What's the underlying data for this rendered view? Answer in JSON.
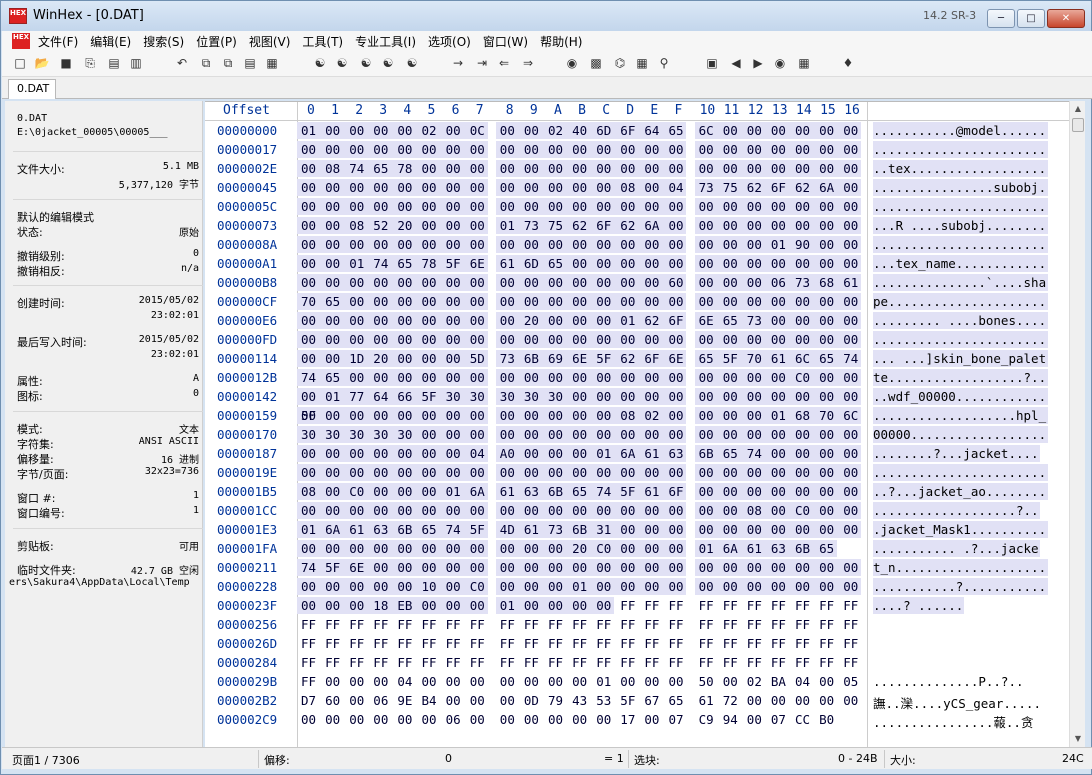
{
  "window": {
    "title": "WinHex - [0.DAT]",
    "version": "14.2 SR-3",
    "icon_label": "HEX"
  },
  "menu": [
    "文件(F)",
    "编辑(E)",
    "搜索(S)",
    "位置(P)",
    "视图(V)",
    "工具(T)",
    "专业工具(I)",
    "选项(O)",
    "窗口(W)",
    "帮助(H)"
  ],
  "tab": {
    "label": "0.DAT"
  },
  "info": {
    "file_name": "0.DAT",
    "file_path": "E:\\0jacket_00005\\00005___",
    "size_label": "文件大小:",
    "size_mb": "5.1 MB",
    "size_bytes": "5,377,120 字节",
    "edit_mode_label": "默认的编辑模式",
    "state_label": "状态:",
    "state_value": "原始",
    "undo_level_label": "撤销级别:",
    "undo_level_value": "0",
    "undo_reverse_label": "撤销相反:",
    "undo_reverse_value": "n/a",
    "created_label": "创建时间:",
    "created_date": "2015/05/02",
    "created_time": "23:02:01",
    "modified_label": "最后写入时间:",
    "modified_date": "2015/05/02",
    "modified_time": "23:02:01",
    "attr_label": "属性:",
    "attr_value": "A",
    "icon_label": "图标:",
    "icon_value": "0",
    "mode_label": "模式:",
    "mode_value": "文本",
    "charset_label": "字符集:",
    "charset_value": "ANSI ASCII",
    "offset_label": "偏移量:",
    "offset_value": "16 进制",
    "bpp_label": "字节/页面:",
    "bpp_value": "32x23=736",
    "win_num_label": "窗口 #:",
    "win_num_value": "1",
    "win_id_label": "窗口编号:",
    "win_id_value": "1",
    "clipboard_label": "剪贴板:",
    "clipboard_value": "可用",
    "temp_label": "临时文件夹:",
    "temp_value": "42.7 GB 空闲",
    "temp_path": "ers\\Sakura4\\AppData\\Local\\Temp"
  },
  "hex": {
    "offset_header": "Offset",
    "columns": [
      "0",
      "1",
      "2",
      "3",
      "4",
      "5",
      "6",
      "7",
      "8",
      "9",
      "A",
      "B",
      "C",
      "D",
      "E",
      "F",
      "10",
      "11",
      "12",
      "13",
      "14",
      "15",
      "16"
    ],
    "rows": [
      {
        "o": "00000000",
        "b": "01 00 00 00 00 02 00 0C 00 00 02 40 6D 6F 64 65 6C 00 00 00 00 00 00",
        "a": "...........@model......"
      },
      {
        "o": "00000017",
        "b": "00 00 00 00 00 00 00 00 00 00 00 00 00 00 00 00 00 00 00 00 00 00 00",
        "a": "......................."
      },
      {
        "o": "0000002E",
        "b": "00 08 74 65 78 00 00 00 00 00 00 00 00 00 00 00 00 00 00 00 00 00 00",
        "a": "..tex.................."
      },
      {
        "o": "00000045",
        "b": "00 00 00 00 00 00 00 00 00 00 00 00 00 08 00 04 73 75 62 6F 62 6A 00",
        "a": "................subobj."
      },
      {
        "o": "0000005C",
        "b": "00 00 00 00 00 00 00 00 00 00 00 00 00 00 00 00 00 00 00 00 00 00 00",
        "a": "......................."
      },
      {
        "o": "00000073",
        "b": "00 00 08 52 20 00 00 00 01 73 75 62 6F 62 6A 00 00 00 00 00 00 00 00",
        "a": "...R ....subobj........"
      },
      {
        "o": "0000008A",
        "b": "00 00 00 00 00 00 00 00 00 00 00 00 00 00 00 00 00 00 00 01 90 00 00",
        "a": "......................."
      },
      {
        "o": "000000A1",
        "b": "00 00 01 74 65 78 5F 6E 61 6D 65 00 00 00 00 00 00 00 00 00 00 00 00",
        "a": "...tex_name............"
      },
      {
        "o": "000000B8",
        "b": "00 00 00 00 00 00 00 00 00 00 00 00 00 00 00 60 00 00 00 06 73 68 61",
        "a": "...............`....sha"
      },
      {
        "o": "000000CF",
        "b": "70 65 00 00 00 00 00 00 00 00 00 00 00 00 00 00 00 00 00 00 00 00 00",
        "a": "pe....................."
      },
      {
        "o": "000000E6",
        "b": "00 00 00 00 00 00 00 00 00 20 00 00 00 01 62 6F 6E 65 73 00 00 00 00",
        "a": "......... ....bones...."
      },
      {
        "o": "000000FD",
        "b": "00 00 00 00 00 00 00 00 00 00 00 00 00 00 00 00 00 00 00 00 00 00 00",
        "a": "......................."
      },
      {
        "o": "00000114",
        "b": "00 00 1D 20 00 00 00 5D 73 6B 69 6E 5F 62 6F 6E 65 5F 70 61 6C 65 74",
        "a": "... ...]skin_bone_palet"
      },
      {
        "o": "0000012B",
        "b": "74 65 00 00 00 00 00 00 00 00 00 00 00 00 00 00 00 00 00 00 C0 00 00",
        "a": "te..................?.."
      },
      {
        "o": "00000142",
        "b": "00 01 77 64 66 5F 30 30 30 30 30 00 00 00 00 00 00 00 00 00 00 00 00",
        "a": "..wdf_00000............"
      },
      {
        "o": "00000159",
        "b": "00 00 00 00 00 00 00 00 00 00 00 00 00 08 02 00 00 00 00 01 68 70 6C 5F",
        "a": "...................hpl_"
      },
      {
        "o": "00000170",
        "b": "30 30 30 30 30 00 00 00 00 00 00 00 00 00 00 00 00 00 00 00 00 00 00",
        "a": "00000.................."
      },
      {
        "o": "00000187",
        "b": "00 00 00 00 00 00 00 04 A0 00 00 00 01 6A 61 63 6B 65 74 00 00 00 00",
        "a": "........?...jacket...."
      },
      {
        "o": "0000019E",
        "b": "00 00 00 00 00 00 00 00 00 00 00 00 00 00 00 00 00 00 00 00 00 00 00",
        "a": "......................."
      },
      {
        "o": "000001B5",
        "b": "08 00 C0 00 00 00 01 6A 61 63 6B 65 74 5F 61 6F 00 00 00 00 00 00 00",
        "a": "..?...jacket_ao........"
      },
      {
        "o": "000001CC",
        "b": "00 00 00 00 00 00 00 00 00 00 00 00 00 00 00 00 00 00 08 00 C0 00 00",
        "a": "...................?.."
      },
      {
        "o": "000001E3",
        "b": "01 6A 61 63 6B 65 74 5F 4D 61 73 6B 31 00 00 00 00 00 00 00 00 00 00",
        "a": ".jacket_Mask1.........."
      },
      {
        "o": "000001FA",
        "b": "00 00 00 00 00 00 00 00 00 00 00 20 C0 00 00 00 01 6A 61 63 6B 65",
        "a": "........... .?...jacke"
      },
      {
        "o": "00000211",
        "b": "74 5F 6E 00 00 00 00 00 00 00 00 00 00 00 00 00 00 00 00 00 00 00 00",
        "a": "t_n...................."
      },
      {
        "o": "00000228",
        "b": "00 00 00 00 00 10 00 C0 00 00 00 01 00 00 00 00 00 00 00 00 00 00 00",
        "a": "...........?..........."
      },
      {
        "o": "0000023F",
        "b": "00 00 00 18 EB 00 00 00 01 00 00 00 00 FF FF FF FF FF FF FF FF FF FF",
        "a": "....? ......"
      },
      {
        "o": "00000256",
        "b": "FF FF FF FF FF FF FF FF FF FF FF FF FF FF FF FF FF FF FF FF FF FF FF",
        "a": ""
      },
      {
        "o": "0000026D",
        "b": "FF FF FF FF FF FF FF FF FF FF FF FF FF FF FF FF FF FF FF FF FF FF FF",
        "a": ""
      },
      {
        "o": "00000284",
        "b": "FF FF FF FF FF FF FF FF FF FF FF FF FF FF FF FF FF FF FF FF FF FF FF",
        "a": ""
      },
      {
        "o": "0000029B",
        "b": "FF 00 00 00 04 00 00 00 00 00 00 00 01 00 00 00 50 00 02 BA 04 00 05",
        "a": "..............P..?.."
      },
      {
        "o": "000002B2",
        "b": "D7 60 00 06 9E B4 00 00 00 0D 79 43 53 5F 67 65 61 72 00 00 00 00 00",
        "a": "譕..灤....yCS_gear....."
      },
      {
        "o": "000002C9",
        "b": "00 00 00 00 00 00 06 00 00 00 00 00 00 17 00 07 C9 94 00 07 CC B0",
        "a": "................蕔..贪"
      }
    ],
    "highlight_color": "#e1e1f5"
  },
  "status": {
    "page_label": "页面1 / 7306",
    "offset_label": "偏移:",
    "offset_value": "0",
    "eq_value": "= 1",
    "block_label": "选块:",
    "block_value": "0 - 24B",
    "size_label": "大小:",
    "size_value": "24C"
  }
}
